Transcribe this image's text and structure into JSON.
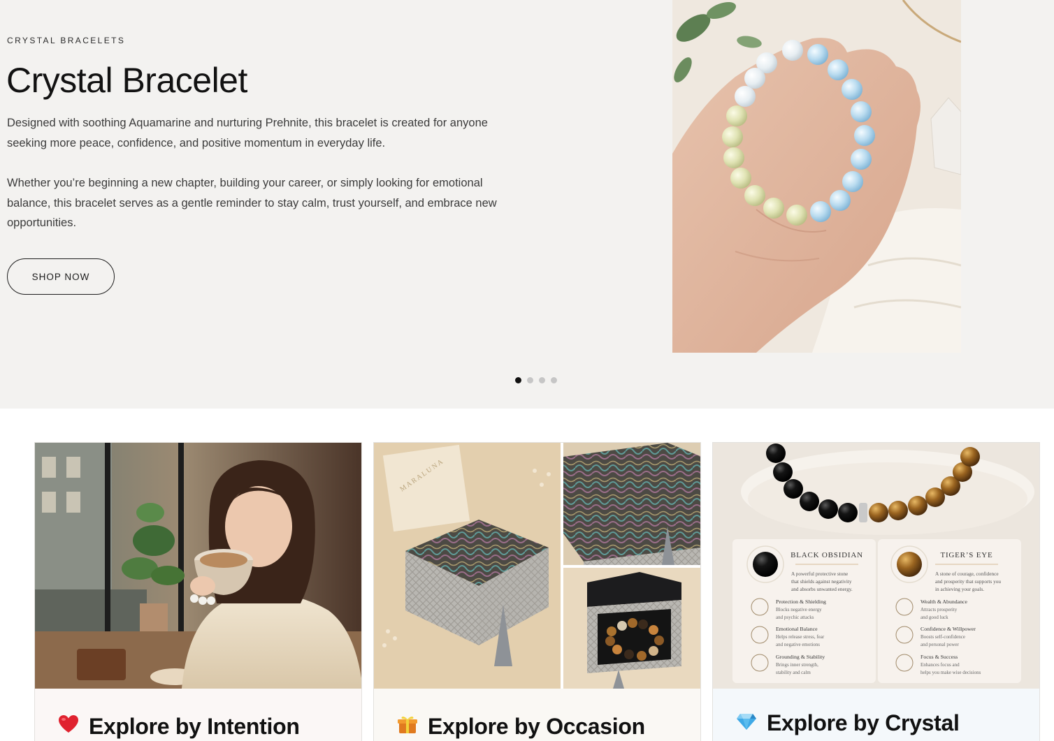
{
  "hero": {
    "eyebrow": "CRYSTAL BRACELETS",
    "title": "Crystal Bracelet",
    "paragraphs": [
      "Designed with soothing Aquamarine and nurturing Prehnite, this bracelet is created for anyone seeking more peace, confidence, and positive momentum in everyday life.",
      "Whether you’re beginning a new chapter, building your career, or simply looking for emotional balance, this bracelet serves as a gentle reminder to stay calm, trust yourself, and embrace new opportunities."
    ],
    "cta_label": "SHOP NOW",
    "image_icon": "bracelet-in-hand-photo",
    "slides_total": 4,
    "active_slide": 1
  },
  "cards": [
    {
      "emoji": "❤️",
      "emoji_icon": "red-heart-icon",
      "label": "Explore by Intention",
      "image_icon": "woman-with-coffee-photo"
    },
    {
      "emoji": "🎁",
      "emoji_icon": "gift-icon",
      "label": "Explore by Occasion",
      "image_icon": "gift-box-collage-photo"
    },
    {
      "emoji": "💎",
      "emoji_icon": "gem-icon",
      "label": "Explore by Crystal",
      "image_icon": "crystal-info-card-photo",
      "info": {
        "left": {
          "name": "BLACK OBSIDIAN",
          "desc": [
            "A powerful protective stone",
            "that shields against negativity",
            "and absorbs unwanted energy."
          ],
          "items": [
            {
              "title": "Protection & Shielding",
              "lines": [
                "Blocks negative energy",
                "and psychic attacks"
              ]
            },
            {
              "title": "Emotional Balance",
              "lines": [
                "Helps release stress, fear",
                "and negative emotions"
              ]
            },
            {
              "title": "Grounding & Stability",
              "lines": [
                "Brings inner strength,",
                "stability and calm"
              ]
            }
          ]
        },
        "right": {
          "name": "TIGER’S EYE",
          "desc": [
            "A stone of courage, confidence",
            "and prosperity that supports you",
            "in achieving your goals."
          ],
          "items": [
            {
              "title": "Wealth & Abundance",
              "lines": [
                "Attracts prosperity",
                "and good luck"
              ]
            },
            {
              "title": "Confidence & Willpower",
              "lines": [
                "Boosts self-confidence",
                "and personal power"
              ]
            },
            {
              "title": "Focus & Success",
              "lines": [
                "Enhances focus and",
                "helps you make wise decisions"
              ]
            }
          ]
        }
      }
    }
  ],
  "colors": {
    "hero_bg": "#f3f2f0",
    "text": "#1c1c1c",
    "dot_active": "#111111",
    "dot_inactive": "#c6c6c6"
  }
}
